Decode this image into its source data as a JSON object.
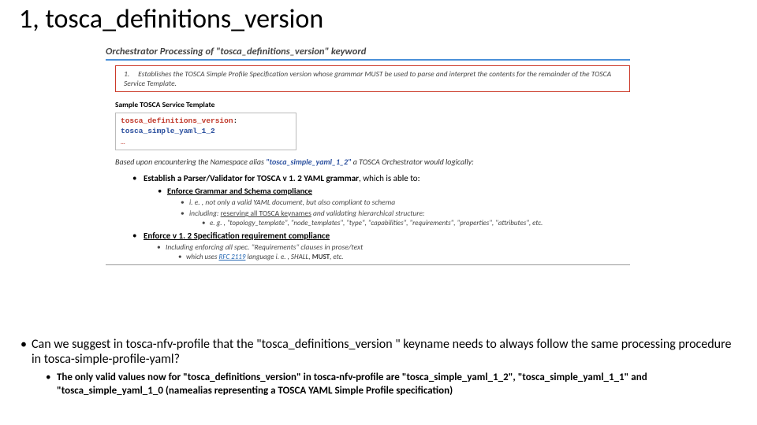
{
  "title": "1, tosca_definitions_version",
  "inner": {
    "heading": "Orchestrator Processing of \"tosca_definitions_version\" keyword",
    "enum_num": "1.",
    "enum_text": "Establishes the TOSCA Simple Profile Specification version whose grammar MUST be used to parse and interpret the contents for the remainder of the TOSCA Service Template.",
    "sample_label": "Sample TOSCA Service Template",
    "code_kw": "tosca_definitions_version",
    "code_colon": ":",
    "code_val": "tosca_simple_yaml_1_2",
    "code_ell": "…",
    "based_pre": "Based upon encountering the Namespace alias ",
    "based_q": "\"tosca_simple_yaml_1_2\"",
    "based_post": " a TOSCA Orchestrator would logically:",
    "b1_pre": "Establish a Parser/Validator for TOSCA v 1. 2 YAML grammar",
    "b1_post": ", which is able to:",
    "b1a": "Enforce Grammar and Schema compliance",
    "b1a_i": "i. e. , not only a valid YAML document, but also compliant to schema",
    "b1a_ii_pre": "including: ",
    "b1a_ii_u": "reserving all TOSCA keynames",
    "b1a_ii_post": " and validating hierarchical structure:",
    "b1a_ii_eg": "e. g. , \"topology_template\", \"node_templates\", \"type\", \"capabilities\", \"requirements\", \"properties\", \"attributes\", etc.",
    "b2": "Enforce v 1. 2 Specification requirement compliance",
    "b2_a": "Including enforcing all spec. \"Requirements\" clauses in prose/text",
    "b2_a_i_pre": "which uses ",
    "b2_a_i_link": "RFC 2119",
    "b2_a_i_mid": " language i. e. , SHALL, ",
    "b2_a_i_bold": "MUST",
    "b2_a_i_post": ", etc."
  },
  "outer": {
    "q": "Can we suggest in tosca-nfv-profile that the \"tosca_definitions_version \" keyname needs to always follow the same processing procedure in tosca-simple-profile-yaml?",
    "sub_pre": "The only valid values now for \"tosca_definitions_version\" in tosca-nfv-profile are ",
    "v1": "\"tosca_simple_yaml_1_2\"",
    "sep1": ", ",
    "v2": "\"tosca_simple_yaml_1_1\"",
    "sep2": " and ",
    "v3": "\"tosca_simple_yaml_1_0",
    "sub_post": " (namealias representing a TOSCA YAML Simple Profile specification)"
  }
}
